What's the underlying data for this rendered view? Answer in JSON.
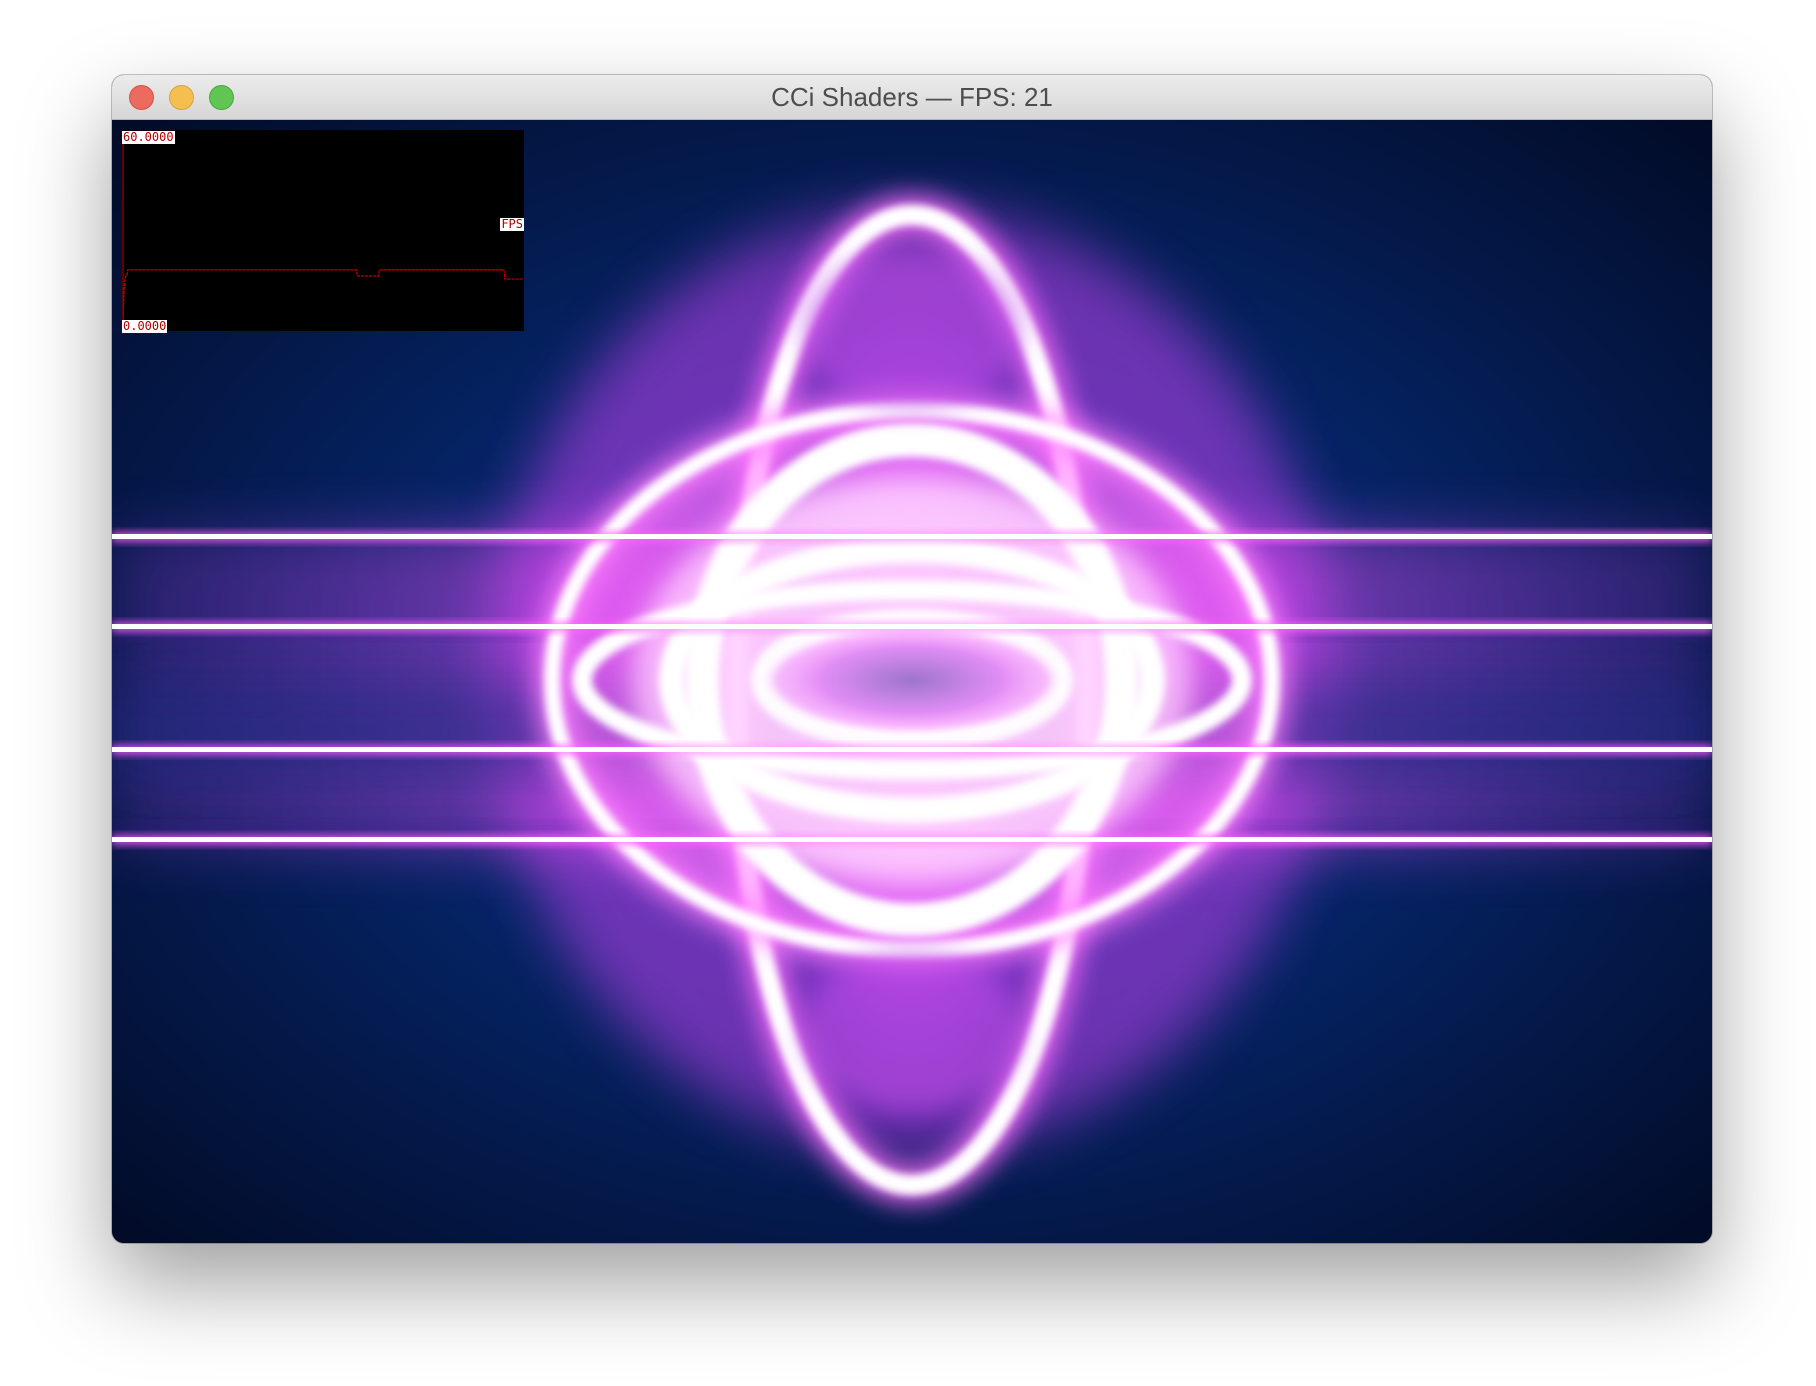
{
  "window": {
    "title": "CCi Shaders — FPS: 21"
  },
  "colors": {
    "background_dark": "#020d2e",
    "background_mid": "#062670",
    "glow_magenta": "#ff4cff",
    "glow_white": "#ffffff",
    "graph_line": "#c80000"
  },
  "fps_graph": {
    "max_label": "60.0000",
    "min_label": "0.0000",
    "series_label": "FPS",
    "max_value": 60,
    "min_value": 0,
    "values": [
      0,
      10,
      14,
      15,
      15,
      17,
      17,
      17,
      17,
      17,
      17,
      17,
      17,
      17,
      17,
      17,
      17,
      17,
      17,
      17,
      17,
      17,
      17,
      17,
      17,
      17,
      17,
      17,
      17,
      17,
      17,
      17,
      17,
      17,
      17,
      17,
      17,
      17,
      17,
      17,
      17,
      17,
      17,
      17,
      17,
      17,
      17,
      17,
      17,
      17,
      17,
      17,
      17,
      17,
      17,
      17,
      17,
      17,
      17,
      17,
      17,
      17,
      17,
      17,
      17,
      17,
      17,
      17,
      17,
      17,
      17,
      17,
      17,
      17,
      17,
      17,
      17,
      17,
      17,
      17,
      17,
      17,
      17,
      17,
      17,
      17,
      17,
      17,
      17,
      17,
      17,
      17,
      17,
      17,
      17,
      17,
      17,
      17,
      17,
      17,
      17,
      17,
      17,
      17,
      17,
      17,
      17,
      17,
      17,
      17,
      17,
      17,
      17,
      17,
      17,
      17,
      17,
      17,
      17,
      17,
      17,
      17,
      17,
      17,
      17,
      17,
      17,
      17,
      17,
      17,
      17,
      17,
      17,
      17,
      17,
      17,
      17,
      17,
      17,
      17,
      17,
      17,
      17,
      17,
      17,
      17,
      17,
      17,
      17,
      17,
      17,
      17,
      17,
      17,
      17,
      17,
      17,
      17,
      17,
      17,
      17,
      17,
      17,
      17,
      17,
      17,
      17,
      17,
      17,
      17,
      17,
      17,
      17,
      17,
      17,
      17,
      17,
      17,
      17,
      17,
      17,
      17,
      17,
      17,
      17,
      17,
      17,
      17,
      17,
      17,
      17,
      17,
      17,
      17,
      17,
      17,
      17,
      17,
      17,
      17,
      17,
      17,
      17,
      17,
      17,
      17,
      17,
      17,
      17,
      17,
      17,
      17,
      17,
      17,
      17,
      17,
      17,
      17,
      17,
      17,
      17,
      17,
      17,
      17,
      17,
      17,
      17,
      17,
      17,
      17,
      17,
      17,
      17,
      17,
      17,
      17,
      17,
      17,
      17,
      17,
      17,
      17,
      17,
      17,
      17,
      15,
      15,
      15,
      15,
      15,
      15,
      15,
      15,
      15,
      15,
      15,
      15,
      15,
      15,
      15,
      15,
      15,
      15,
      15,
      15,
      15,
      15,
      15,
      17,
      17,
      17,
      17,
      17,
      17,
      17,
      17,
      17,
      17,
      17,
      17,
      17,
      17,
      17,
      17,
      17,
      17,
      17,
      17,
      17,
      17,
      17,
      17,
      17,
      17,
      17,
      17,
      17,
      17,
      17,
      17,
      17,
      17,
      17,
      17,
      17,
      17,
      17,
      17,
      17,
      17,
      17,
      17,
      17,
      17,
      17,
      17,
      17,
      17,
      17,
      17,
      17,
      17,
      17,
      17,
      17,
      17,
      17,
      17,
      17,
      17,
      17,
      17,
      17,
      17,
      17,
      17,
      17,
      17,
      17,
      17,
      17,
      17,
      17,
      17,
      17,
      17,
      17,
      17,
      17,
      17,
      17,
      17,
      17,
      17,
      17,
      17,
      17,
      17,
      17,
      17,
      17,
      17,
      17,
      17,
      17,
      17,
      17,
      17,
      17,
      17,
      17,
      17,
      17,
      17,
      17,
      17,
      17,
      17,
      17,
      17,
      17,
      17,
      17,
      17,
      17,
      17,
      17,
      17,
      17,
      17,
      17,
      17,
      17,
      17,
      17,
      17,
      17,
      17,
      17,
      14,
      14,
      14,
      14,
      14,
      14,
      14,
      14,
      14,
      14,
      14,
      14,
      14,
      14,
      14,
      14,
      14,
      14,
      14,
      14
    ]
  }
}
